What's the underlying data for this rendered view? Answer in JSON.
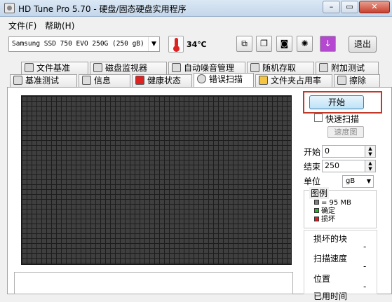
{
  "window": {
    "title": "HD Tune Pro 5.70 - 硬盘/固态硬盘实用程序",
    "controls": [
      "–",
      "▭",
      "✕"
    ]
  },
  "menu": [
    "文件(F)",
    "帮助(H)"
  ],
  "toolbar": {
    "drive": "Samsung SSD 750 EVO 250G (250 gB)",
    "temperature": "34℃",
    "exit_label": "退出"
  },
  "tabs_top": [
    "文件基准",
    "磁盘监视器",
    "自动噪音管理",
    "随机存取",
    "附加测试"
  ],
  "tabs_bottom": [
    "基准测试",
    "信息",
    "健康状态",
    "错误扫描",
    "文件夹占用率",
    "擦除"
  ],
  "active_tab": "错误扫描",
  "controls": {
    "start_label": "开始",
    "quick_scan_label": "快速扫描",
    "quick_scan_checked": false,
    "map_button_label": "速度图",
    "start_field_label": "开始",
    "start_value": "0",
    "end_field_label": "结束",
    "end_value": "250",
    "unit_label": "单位",
    "unit_value": "gB"
  },
  "legend": {
    "title": "图例",
    "block_size": "= 95 MB",
    "ok_label": "确定",
    "bad_label": "损坏"
  },
  "stats": {
    "bad_blocks_label": "损坏的块",
    "bad_blocks_value": "-",
    "scan_speed_label": "扫描速度",
    "scan_speed_value": "-",
    "position_label": "位置",
    "position_value": "-",
    "elapsed_label": "已用时间"
  },
  "colors": {
    "ok": "#21b521",
    "bad": "#e11b1b",
    "block": "#808080",
    "highlight": "#c0392b"
  }
}
